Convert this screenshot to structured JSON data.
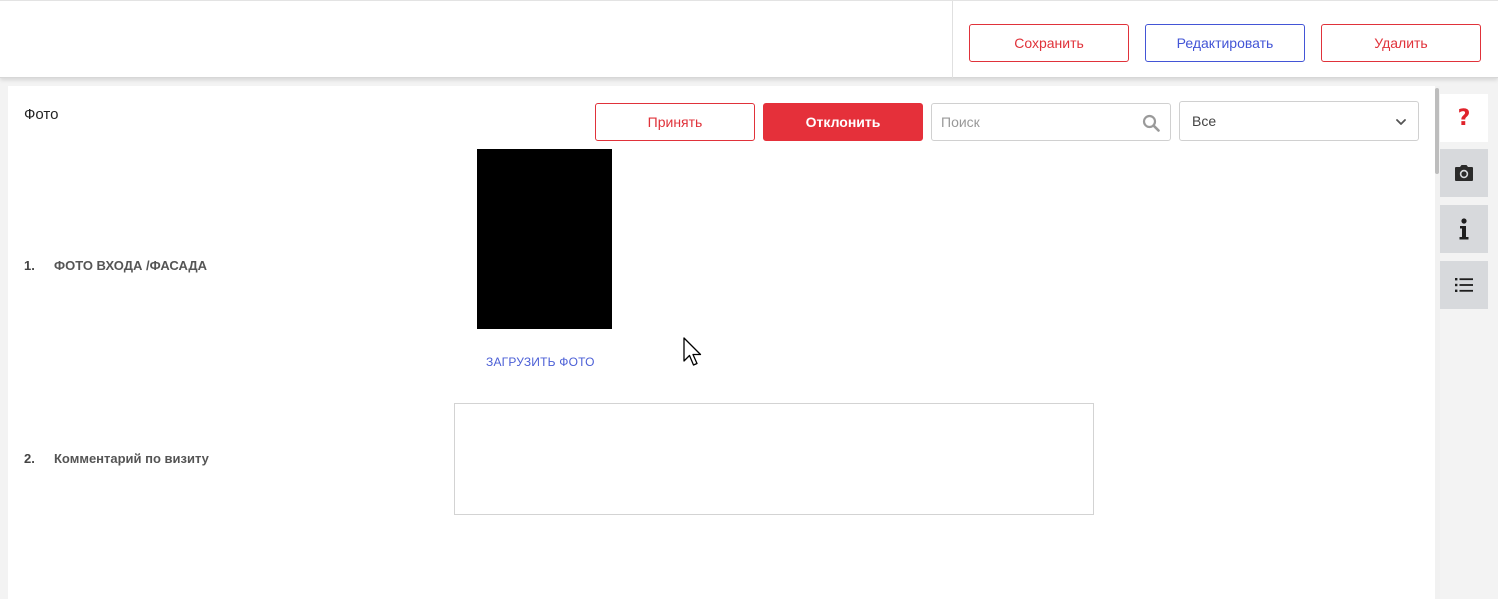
{
  "toolbar": {
    "save_label": "Сохранить",
    "edit_label": "Редактировать",
    "delete_label": "Удалить"
  },
  "section": {
    "title": "Фото",
    "accept_label": "Принять",
    "reject_label": "Отклонить",
    "search_placeholder": "Поиск",
    "filter_value": "Все"
  },
  "rows": [
    {
      "num": "1.",
      "label": "ФОТО ВХОДА /ФАСАДА",
      "upload_label": "ЗАГРУЗИТЬ ФОТО"
    },
    {
      "num": "2.",
      "label": "Комментарий по визиту",
      "comment": ""
    }
  ],
  "sidebar": {
    "icons": [
      "help-icon",
      "camera-icon",
      "info-icon",
      "list-icon"
    ]
  },
  "colors": {
    "accent_red": "#e5303a",
    "accent_blue": "#4355d6",
    "sidebar_gray": "#d7d9dc"
  }
}
